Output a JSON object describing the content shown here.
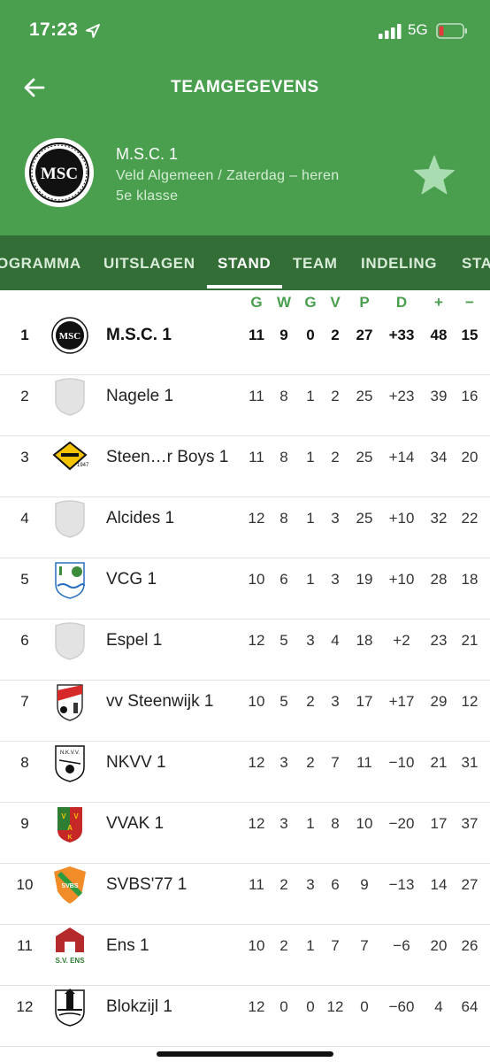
{
  "status": {
    "time": "17:23",
    "network": "5G"
  },
  "nav": {
    "title": "TEAMGEGEVENS"
  },
  "team": {
    "name": "M.S.C. 1",
    "subtitle": "Veld Algemeen / Zaterdag – heren",
    "class": "5e klasse",
    "logo_text": "MSC"
  },
  "tabs": [
    "OGRAMMA",
    "UITSLAGEN",
    "STAND",
    "TEAM",
    "INDELING",
    "STA"
  ],
  "active_tab": "STAND",
  "columns": [
    "G",
    "W",
    "G",
    "V",
    "P",
    "D",
    "+",
    "−"
  ],
  "colors": {
    "header": "#4a9f4f",
    "tabs": "#336e36",
    "accent": "#4a9f4f"
  },
  "rows": [
    {
      "rank": "1",
      "name": "M.S.C. 1",
      "logo": "msc-logo",
      "G": "11",
      "W": "9",
      "G2": "0",
      "V": "2",
      "P": "27",
      "D": "+33",
      "plus": "48",
      "minus": "15"
    },
    {
      "rank": "2",
      "name": "Nagele 1",
      "logo": "shield-placeholder",
      "G": "11",
      "W": "8",
      "G2": "1",
      "V": "2",
      "P": "25",
      "D": "+23",
      "plus": "39",
      "minus": "16"
    },
    {
      "rank": "3",
      "name": "Steen…r Boys 1",
      "logo": "steenwijkerwold-logo",
      "G": "11",
      "W": "8",
      "G2": "1",
      "V": "2",
      "P": "25",
      "D": "+14",
      "plus": "34",
      "minus": "20"
    },
    {
      "rank": "4",
      "name": "Alcides 1",
      "logo": "shield-placeholder",
      "G": "12",
      "W": "8",
      "G2": "1",
      "V": "3",
      "P": "25",
      "D": "+10",
      "plus": "32",
      "minus": "22"
    },
    {
      "rank": "5",
      "name": "VCG 1",
      "logo": "vcg-logo",
      "G": "10",
      "W": "6",
      "G2": "1",
      "V": "3",
      "P": "19",
      "D": "+10",
      "plus": "28",
      "minus": "18"
    },
    {
      "rank": "6",
      "name": "Espel 1",
      "logo": "shield-placeholder",
      "G": "12",
      "W": "5",
      "G2": "3",
      "V": "4",
      "P": "18",
      "D": "+2",
      "plus": "23",
      "minus": "21"
    },
    {
      "rank": "7",
      "name": "vv Steenwijk 1",
      "logo": "steenwijk-logo",
      "G": "10",
      "W": "5",
      "G2": "2",
      "V": "3",
      "P": "17",
      "D": "+17",
      "plus": "29",
      "minus": "12"
    },
    {
      "rank": "8",
      "name": "NKVV 1",
      "logo": "nkvv-logo",
      "G": "12",
      "W": "3",
      "G2": "2",
      "V": "7",
      "P": "11",
      "D": "−10",
      "plus": "21",
      "minus": "31"
    },
    {
      "rank": "9",
      "name": "VVAK 1",
      "logo": "vvak-logo",
      "G": "12",
      "W": "3",
      "G2": "1",
      "V": "8",
      "P": "10",
      "D": "−20",
      "plus": "17",
      "minus": "37"
    },
    {
      "rank": "10",
      "name": "SVBS'77 1",
      "logo": "svbs-logo",
      "G": "11",
      "W": "2",
      "G2": "3",
      "V": "6",
      "P": "9",
      "D": "−13",
      "plus": "14",
      "minus": "27"
    },
    {
      "rank": "11",
      "name": "Ens 1",
      "logo": "ens-logo",
      "G": "10",
      "W": "2",
      "G2": "1",
      "V": "7",
      "P": "7",
      "D": "−6",
      "plus": "20",
      "minus": "26"
    },
    {
      "rank": "12",
      "name": "Blokzijl 1",
      "logo": "blokzijl-logo",
      "G": "12",
      "W": "0",
      "G2": "0",
      "V": "12",
      "P": "0",
      "D": "−60",
      "plus": "4",
      "minus": "64"
    }
  ]
}
